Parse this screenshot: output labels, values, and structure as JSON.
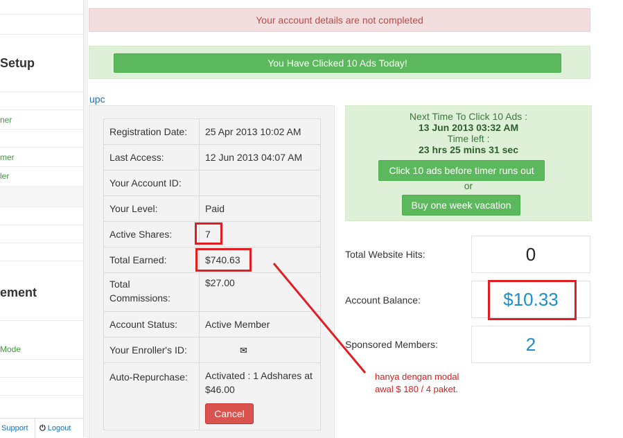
{
  "sidebar": {
    "section_setup": "Setup",
    "link_1": "ner",
    "link_2": "mer",
    "link_3": "ler",
    "section_management": "ement",
    "link_mode": "Mode",
    "footer_support": "Support",
    "footer_logout": "Logout"
  },
  "alerts": {
    "incomplete": "Your account details are not completed",
    "clicked_today": "You Have Clicked 10 Ads Today!"
  },
  "username": "upc",
  "account": {
    "rows": [
      {
        "label": "Registration Date:",
        "value": "25 Apr 2013 10:02 AM"
      },
      {
        "label": "Last Access:",
        "value": "12 Jun 2013 04:07 AM"
      },
      {
        "label": "Your Account ID:",
        "value": ""
      },
      {
        "label": "Your Level:",
        "value": "Paid"
      },
      {
        "label": "Active Shares:",
        "value": "7"
      },
      {
        "label": "Total Earned:",
        "value": "$740.63"
      },
      {
        "label": "Total Commissions:",
        "value": "$27.00"
      },
      {
        "label": "Account Status:",
        "value": "Active Member"
      },
      {
        "label": "Your Enroller's ID:",
        "value": ""
      },
      {
        "label": "Auto-Repurchase:",
        "value": "Activated : 1 Adshares at $46.00"
      }
    ],
    "cancel_label": "Cancel"
  },
  "timer": {
    "next_time_label": "Next Time To Click 10 Ads :",
    "next_time_value": "13 Jun 2013 03:32 AM",
    "time_left_label": "Time left :",
    "time_left_value": "23 hrs 25 mins 31 sec",
    "click_button": "Click 10 ads before timer runs out",
    "or": "or",
    "vacation_button": "Buy one week vacation"
  },
  "stats": {
    "hits_label": "Total Website Hits:",
    "hits_value": "0",
    "balance_label": "Account Balance:",
    "balance_value": "$10.33",
    "sponsored_label": "Sponsored Members:",
    "sponsored_value": "2"
  },
  "annotation": {
    "line1": "hanya dengan modal",
    "line2": "awal $ 180 / 4 paket."
  },
  "colors": {
    "highlight": "#e11d22",
    "stat_value": "#1a8fc9",
    "link": "#1a6fb5"
  }
}
